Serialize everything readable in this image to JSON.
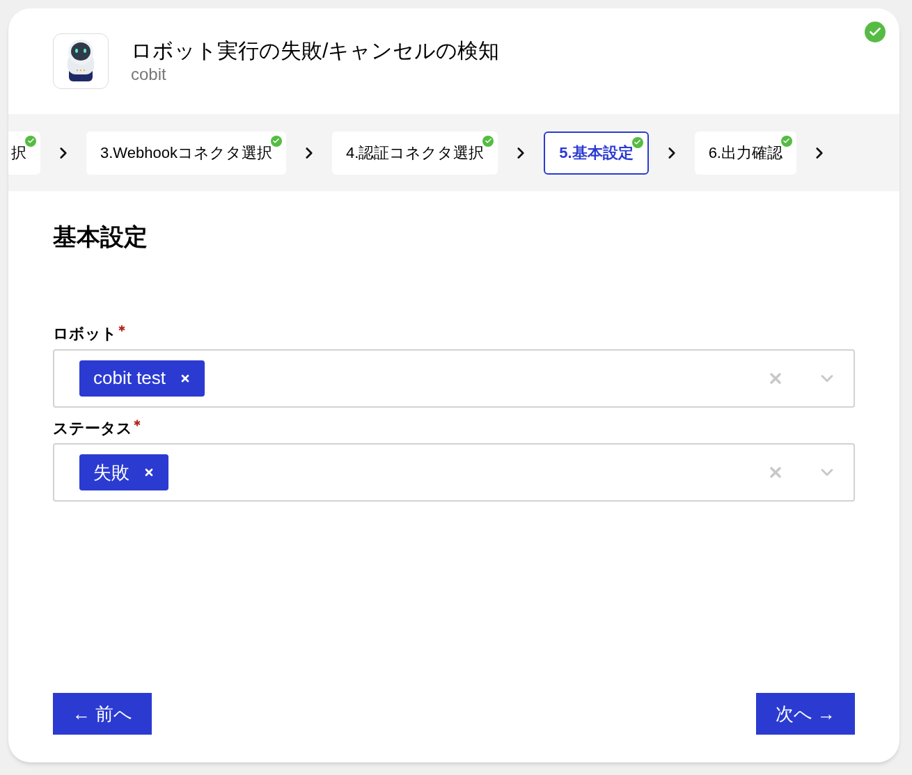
{
  "header": {
    "title": "ロボット実行の失敗/キャンセルの検知",
    "subtitle": "cobit",
    "completed": true
  },
  "steps": [
    {
      "label": "択",
      "done": true,
      "selected": false
    },
    {
      "label": "3.Webhookコネクタ選択",
      "done": true,
      "selected": false
    },
    {
      "label": "4.認証コネクタ選択",
      "done": true,
      "selected": false
    },
    {
      "label": "5.基本設定",
      "done": true,
      "selected": true
    },
    {
      "label": "6.出力確認",
      "done": true,
      "selected": false
    }
  ],
  "section_title": "基本設定",
  "fields": [
    {
      "label": "ロボット",
      "required": true,
      "tags": [
        "cobit test"
      ]
    },
    {
      "label": "ステータス",
      "required": true,
      "tags": [
        "失敗"
      ]
    }
  ],
  "buttons": {
    "prev": "← 前へ",
    "next": "次へ →"
  }
}
